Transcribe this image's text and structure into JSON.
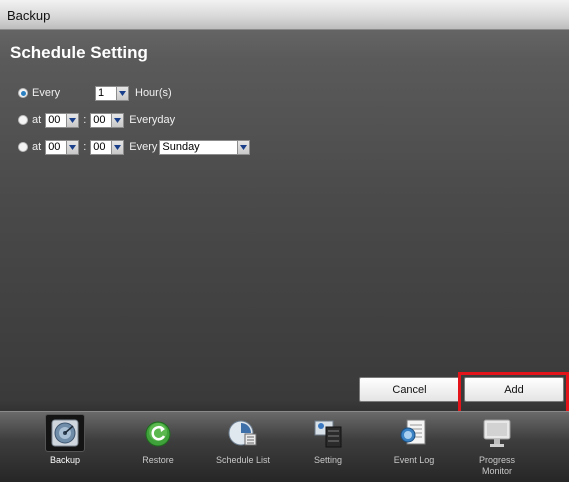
{
  "window": {
    "title": "Backup"
  },
  "page": {
    "heading": "Schedule Setting"
  },
  "schedule": {
    "option_every": {
      "radio_label": "Every",
      "hour_value": "1",
      "unit_label": "Hour(s)",
      "selected": true
    },
    "option_daily": {
      "prefix": "at",
      "hour_value": "00",
      "minute_value": "00",
      "suffix": "Everyday",
      "separator": ":",
      "selected": false
    },
    "option_weekly": {
      "prefix": "at",
      "hour_value": "00",
      "minute_value": "00",
      "separator": ":",
      "every_label": "Every",
      "day_value": "Sunday",
      "selected": false
    }
  },
  "buttons": {
    "cancel": "Cancel",
    "add": "Add"
  },
  "taskbar": {
    "items": [
      {
        "label": "Backup",
        "icon": "backup-icon",
        "active": true
      },
      {
        "label": "Restore",
        "icon": "restore-icon"
      },
      {
        "label": "Schedule List",
        "icon": "schedule-list-icon"
      },
      {
        "label": "Setting",
        "icon": "setting-icon"
      },
      {
        "label": "Event Log",
        "icon": "event-log-icon"
      },
      {
        "label": "Progress Monitor",
        "icon": "progress-monitor-icon"
      }
    ]
  },
  "colors": {
    "highlight": "#e3151b",
    "radio_selected": "#2a7fc0"
  }
}
